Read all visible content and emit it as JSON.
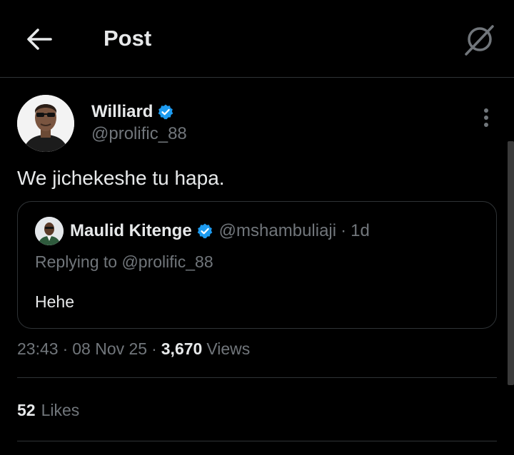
{
  "header": {
    "title": "Post",
    "back_icon": "arrow-left-icon",
    "grok_icon": "grok-icon"
  },
  "post": {
    "author": {
      "name": "Williard",
      "handle": "@prolific_88",
      "verified": true
    },
    "text": "We jichekeshe tu hapa.",
    "quote": {
      "author_name": "Maulid Kitenge",
      "author_handle": "@mshambuliaji",
      "dot": "·",
      "time": "1d",
      "replying_to": "Replying to @prolific_88",
      "text": "Hehe"
    },
    "meta": {
      "time": "23:43",
      "date": "08 Nov 25",
      "separator": "·",
      "views_count": "3,670",
      "views_label": "Views"
    },
    "likes": {
      "count": "52",
      "label": "Likes"
    }
  },
  "colors": {
    "background": "#000000",
    "text_primary": "#e7e9ea",
    "text_secondary": "#71767b",
    "border": "#2f3336",
    "verified_blue": "#1d9bf0"
  }
}
